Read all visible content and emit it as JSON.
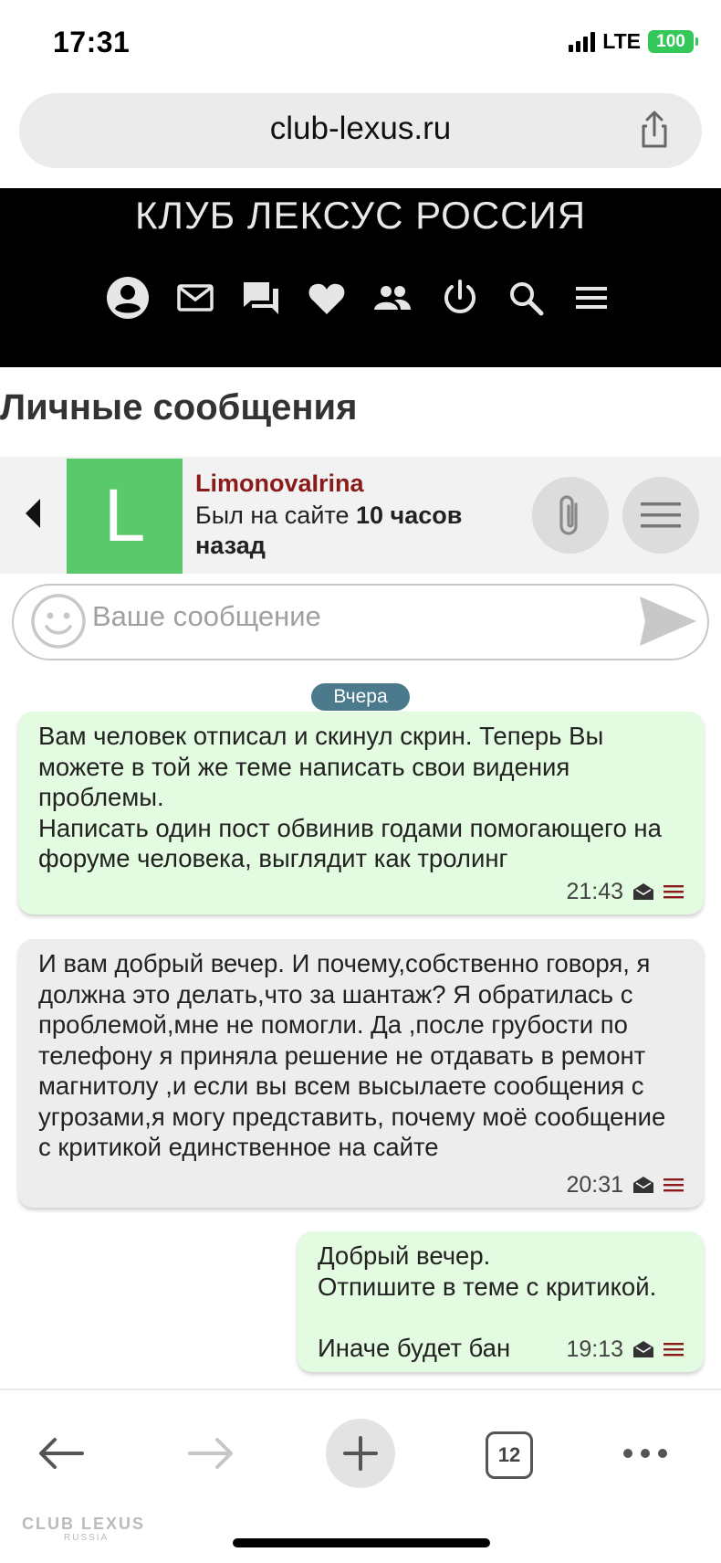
{
  "status": {
    "time": "17:31",
    "network": "LTE",
    "battery": "100"
  },
  "browser": {
    "url": "club-lexus.ru"
  },
  "site": {
    "title": "КЛУБ ЛЕКСУС РОССИЯ",
    "nav_icons": [
      "account-icon",
      "mail-icon",
      "chat-icon",
      "heart-icon",
      "group-icon",
      "power-icon",
      "search-icon",
      "menu-icon"
    ]
  },
  "page": {
    "title": "Личные сообщения"
  },
  "conversation": {
    "avatar_letter": "L",
    "avatar_color": "#5ac96b",
    "user_name": "LimonovaIrina",
    "seen_prefix": "Был на сайте ",
    "seen_bold": "10 часов назад"
  },
  "composer": {
    "placeholder": "Ваше сообщение"
  },
  "date_badge": "Вчера",
  "messages": [
    {
      "direction": "out",
      "text": "Вам человек отписал и скинул скрин. Теперь Вы можете в той же теме написать свои видения проблемы.\nНаписать один пост обвинив годами помогающего на форуме человека, выглядит как тролинг",
      "time": "21:43"
    },
    {
      "direction": "in",
      "text": "И вам добрый вечер. И почему,собственно говоря, я должна это делать,что за шантаж? Я обратилась с проблемой,мне не помогли. Да ,после грубости по телефону я приняла решение не отдавать в ремонт магнитолу ,и если вы всем высылаете сообщения с угрозами,я могу представить, почему моё сообщение с критикой единственное на сайте",
      "time": "20:31"
    },
    {
      "direction": "out",
      "text": "Добрый вечер.\nОтпишите в теме с критикой.\n\nИначе будет бан",
      "time": "19:13"
    }
  ],
  "toolbar": {
    "tabs_count": "12"
  },
  "watermark": {
    "line1": "CLUB LEXUS",
    "line2": "RUSSIA"
  },
  "colors": {
    "outgoing": "#e3fbe0",
    "incoming": "#ededed",
    "username": "#8b1a1a",
    "badge": "#4a7a8c"
  }
}
